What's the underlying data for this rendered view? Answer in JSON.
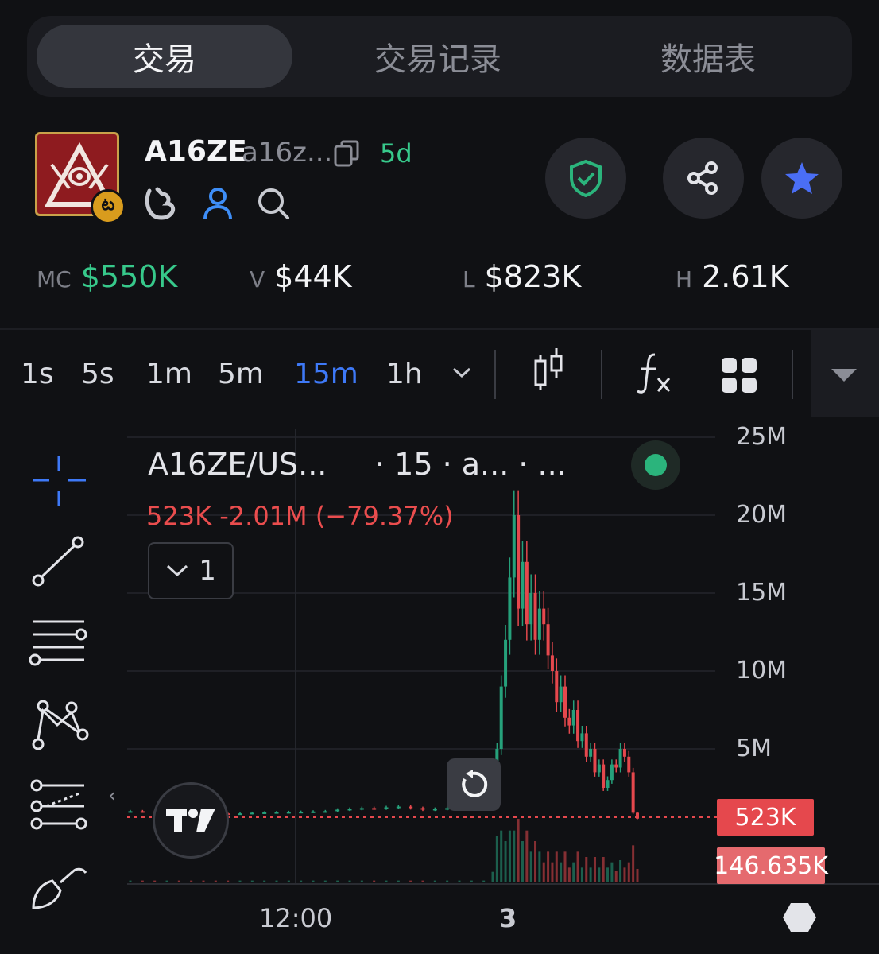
{
  "tabs": [
    {
      "label": "交易",
      "active": true
    },
    {
      "label": "交易记录",
      "active": false
    },
    {
      "label": "数据表",
      "active": false
    }
  ],
  "token": {
    "name": "A16ZE",
    "address": "a16z...",
    "age": "5d",
    "logo_colors": {
      "bg": "#8e1b1f",
      "border": "#c9a24a"
    }
  },
  "header_icons": [
    "pump-icon",
    "user-icon",
    "search-icon"
  ],
  "actions": [
    "shield-check-icon",
    "share-icon",
    "star-icon"
  ],
  "stats": [
    {
      "key": "MC",
      "value": "$550K",
      "color": "#37c98b"
    },
    {
      "key": "V",
      "value": "$44K"
    },
    {
      "key": "L",
      "value": "$823K"
    },
    {
      "key": "H",
      "value": "2.61K"
    }
  ],
  "timeframes": [
    "1s",
    "5s",
    "1m",
    "5m",
    "15m",
    "1h"
  ],
  "active_timeframe": "15m",
  "chart_tools": [
    "candle-type-icon",
    "indicators-icon",
    "layout-grid-icon",
    "dropdown-icon"
  ],
  "drawing_tools": [
    "crosshair-icon",
    "trendline-icon",
    "horizontal-lines-icon",
    "pattern-icon",
    "fib-icon",
    "brush-icon"
  ],
  "legend": {
    "title": "A16ZE/US...",
    "sub": "· 15 · a...   · ...",
    "price": "523K",
    "change": "-2.01M",
    "change_pct": "(−79.37%)",
    "collapse_count": "1"
  },
  "colors": {
    "up": "#26a17b",
    "down": "#e5484d",
    "accent": "#3e79f7"
  },
  "chart_data": {
    "type": "candlestick",
    "y_axis_labels": [
      "25M",
      "20M",
      "15M",
      "10M",
      "5M"
    ],
    "ylim": [
      0,
      25000000
    ],
    "x_tick_labels": [
      "12:00",
      "3"
    ],
    "current_price": "523K",
    "volume_tag": "146.635K",
    "series_close": [
      1000000,
      980000,
      950000,
      970000,
      940000,
      900000,
      880000,
      860000,
      850000,
      860000,
      900000,
      920000,
      940000,
      950000,
      960000,
      980000,
      1000000,
      1100000,
      1150000,
      1200000,
      1180000,
      1250000,
      1300000,
      1200000,
      1100000,
      1150000,
      1200000,
      1250000,
      1300000,
      1400000,
      1500000,
      5000000,
      9000000,
      12000000,
      16000000,
      20000000,
      14000000,
      17000000,
      13000000,
      15000000,
      12000000,
      14000000,
      13000000,
      11000000,
      10000000,
      8000000,
      9000000,
      7000000,
      6500000,
      7500000,
      5500000,
      6000000,
      4500000,
      5000000,
      3500000,
      4000000,
      2500000,
      3000000,
      4000000,
      3800000,
      5000000,
      4500000,
      3500000,
      900000,
      523000
    ]
  }
}
